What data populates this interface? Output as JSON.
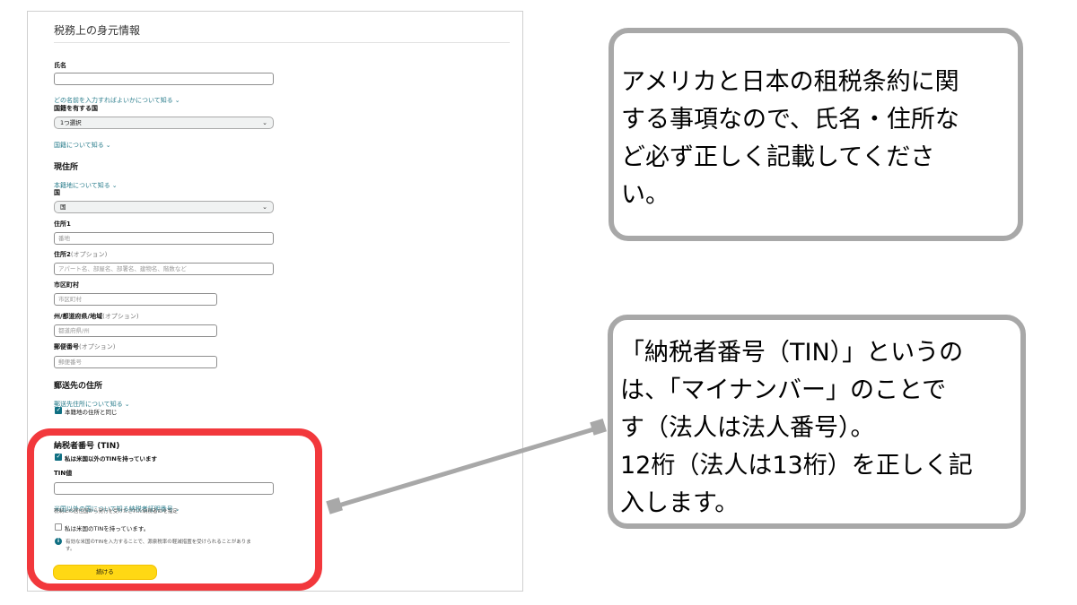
{
  "form": {
    "page_title": "税務上の身元情報",
    "name_label": "氏名",
    "name_help_link": "どの名前を入力すればよいかについて知る",
    "nationality_label": "国籍を有する国",
    "nationality_select": "1つ選択",
    "nationality_help_link": "国籍について知る",
    "address_section": "現住所",
    "address_help_link": "本籍地について知る",
    "country_label": "国",
    "country_select": "国",
    "address1_label": "住所1",
    "address1_placeholder": "番地",
    "address2_label": "住所2",
    "address2_optional": "(オプション)",
    "address2_placeholder": "アパート名、部屋名、部署名、建物名、階数など",
    "city_label": "市区町村",
    "city_placeholder": "市区町村",
    "state_label": "州/都道府県/地域",
    "state_optional": "(オプション)",
    "state_placeholder": "都道府県/州",
    "zip_label": "郵便番号",
    "zip_optional": "(オプション)",
    "zip_placeholder": "郵便番号",
    "mailing_section": "郵送先の住所",
    "mailing_help_link": "郵送先住所について知る",
    "mailing_same_checkbox": "本籍地の住所と同じ",
    "tin_section": "納税者番号 (TIN)",
    "tin_foreign_checkbox": "私は米国以外のTINを持っています",
    "tin_value_label": "TIN値",
    "tin_help_link": "米国以外の国について知る納税者証明番号",
    "tin_help_note": "税制上の居住国から発行を受けたされた納税者IDを指定",
    "tin_us_checkbox": "私は米国のTINを持っています。",
    "tin_info_note_1": "有効な米国のTINを入力することで、源泉税率の軽減措置を受けられることがありま",
    "tin_info_note_2": "す。",
    "continue_button": "続ける"
  },
  "callouts": {
    "callout1": "アメリカと日本の租税条約に関\nする事項なので、氏名・住所な\nど必ず正しく記載してくださ\nい。",
    "callout2": "「納税者番号（TIN）」というの\nは、「マイナンバー」のことで\nす（法人は法人番号）。\n12桁（法人は13桁）を正しく記\n入します。"
  },
  "colors": {
    "highlight": "#f2383c",
    "callout_border": "#a8a8a8",
    "link": "#2a7d8c",
    "checkbox": "#0f6f82",
    "button": "#ffd814"
  },
  "checkboxes": {
    "mailing_same": true,
    "tin_foreign": true,
    "tin_us": false
  }
}
